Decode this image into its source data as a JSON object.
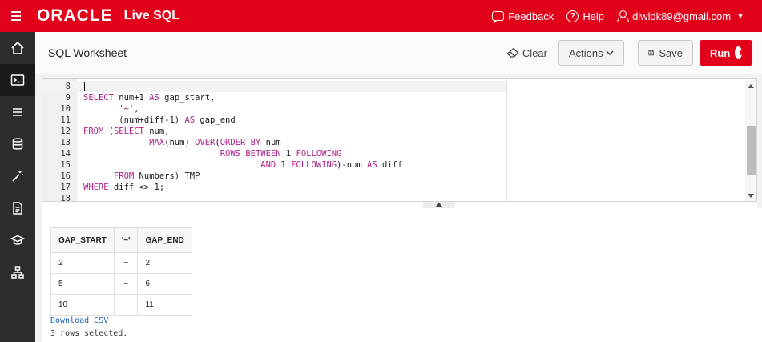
{
  "topbar": {
    "logo": "ORACLE",
    "product": "Live SQL",
    "feedback": "Feedback",
    "help": "Help",
    "user": "dlwldk89@gmail.com"
  },
  "sidebar": {
    "items": [
      {
        "icon": "home-icon"
      },
      {
        "icon": "terminal-icon",
        "active": true
      },
      {
        "icon": "list-icon"
      },
      {
        "icon": "database-icon"
      },
      {
        "icon": "magic-wand-icon"
      },
      {
        "icon": "document-icon"
      },
      {
        "icon": "graduation-cap-icon"
      },
      {
        "icon": "schema-icon"
      }
    ]
  },
  "header": {
    "title": "SQL Worksheet",
    "clear_label": "Clear",
    "actions_label": "Actions",
    "save_label": "Save",
    "run_label": "Run"
  },
  "editor": {
    "lines": [
      {
        "n": "8",
        "text": ""
      },
      {
        "n": "9",
        "text": "SELECT num+1 AS gap_start,"
      },
      {
        "n": "10",
        "text": "       '~',"
      },
      {
        "n": "11",
        "text": "       (num+diff-1) AS gap_end"
      },
      {
        "n": "12",
        "text": "FROM (SELECT num,"
      },
      {
        "n": "13",
        "text": "             MAX(num) OVER(ORDER BY num"
      },
      {
        "n": "14",
        "text": "                           ROWS BETWEEN 1 FOLLOWING"
      },
      {
        "n": "15",
        "text": "                                   AND 1 FOLLOWING)-num AS diff"
      },
      {
        "n": "16",
        "text": "      FROM Numbers) TMP"
      },
      {
        "n": "17",
        "text": "WHERE diff <> 1;"
      },
      {
        "n": "18",
        "text": ""
      }
    ]
  },
  "results": {
    "columns": [
      "GAP_START",
      "'~'",
      "GAP_END"
    ],
    "rows": [
      [
        "2",
        "~",
        "2"
      ],
      [
        "5",
        "~",
        "6"
      ],
      [
        "10",
        "~",
        "11"
      ]
    ],
    "download_label": "Download CSV",
    "row_count": "3 rows selected."
  }
}
